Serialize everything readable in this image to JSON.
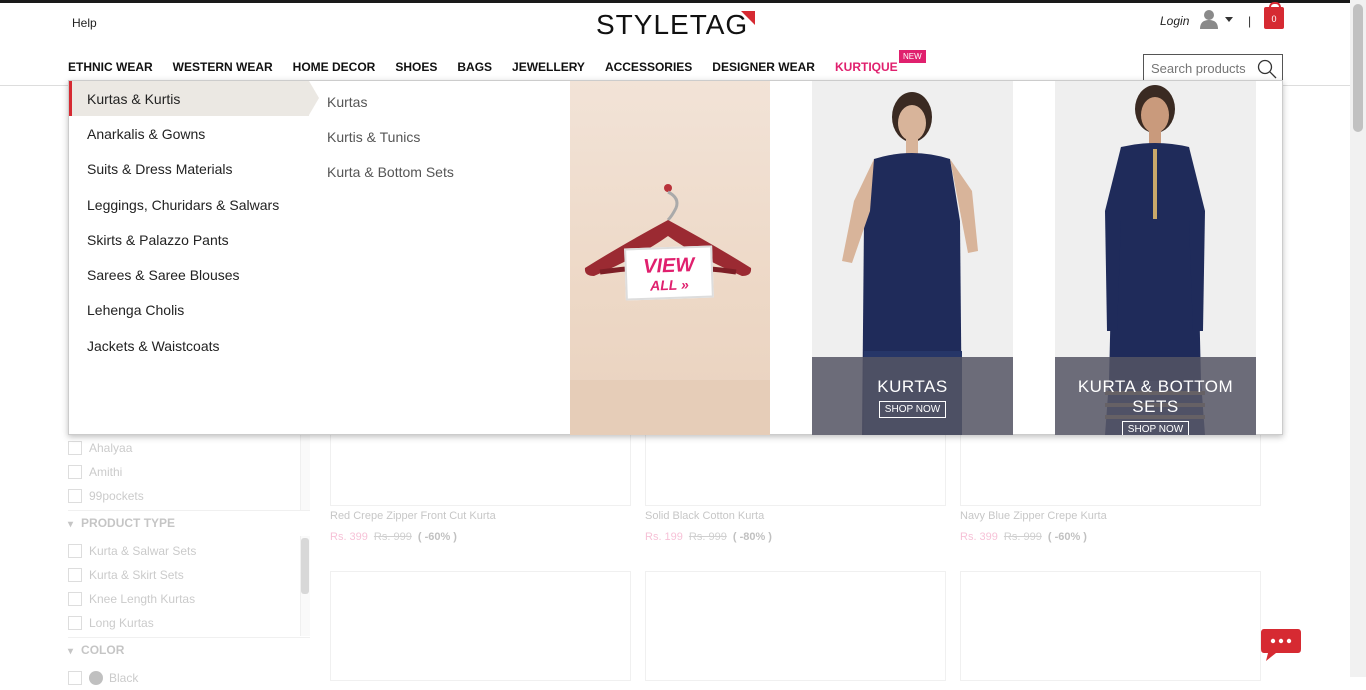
{
  "header": {
    "help": "Help",
    "logo": "STYLETAG",
    "login": "Login",
    "separator": "|",
    "cart_count": "0",
    "search_placeholder": "Search products"
  },
  "nav": {
    "items": [
      "ETHNIC WEAR",
      "WESTERN WEAR",
      "HOME DECOR",
      "SHOES",
      "BAGS",
      "JEWELLERY",
      "ACCESSORIES",
      "DESIGNER WEAR",
      "KURTIQUE"
    ],
    "new_badge": "NEW"
  },
  "mega_menu": {
    "categories": [
      "Kurtas & Kurtis",
      "Anarkalis & Gowns",
      "Suits & Dress Materials",
      "Leggings, Churidars & Salwars",
      "Skirts & Palazzo Pants",
      "Sarees & Saree Blouses",
      "Lehenga Cholis",
      "Jackets & Waistcoats"
    ],
    "subcategories": [
      "Kurtas",
      "Kurtis & Tunics",
      "Kurta & Bottom Sets"
    ],
    "view_all": {
      "line1": "VIEW",
      "line2": "ALL »"
    },
    "promos": [
      {
        "title": "KURTAS",
        "cta": "SHOP NOW"
      },
      {
        "title": "KURTA & BOTTOM SETS",
        "cta": "SHOP NOW"
      }
    ]
  },
  "filters": {
    "brands": [
      "Ahalyaa",
      "Amithi",
      "99pockets"
    ],
    "product_type_heading": "PRODUCT TYPE",
    "product_types": [
      "Kurta & Salwar Sets",
      "Kurta & Skirt Sets",
      "Knee Length Kurtas",
      "Long Kurtas"
    ],
    "color_heading": "COLOR",
    "colors": [
      "Black"
    ]
  },
  "products": [
    {
      "title": "Red Crepe Zipper Front Cut Kurta",
      "price": "Rs. 399",
      "old_price": "Rs. 999",
      "discount": "( -60% )"
    },
    {
      "title": "Solid Black Cotton Kurta",
      "price": "Rs. 199",
      "old_price": "Rs. 999",
      "discount": "( -80% )"
    },
    {
      "title": "Navy Blue Zipper Crepe Kurta",
      "price": "Rs. 399",
      "old_price": "Rs. 999",
      "discount": "( -60% )"
    }
  ],
  "colors": {
    "accent": "#e0206e",
    "brand_red": "#d62a32"
  }
}
